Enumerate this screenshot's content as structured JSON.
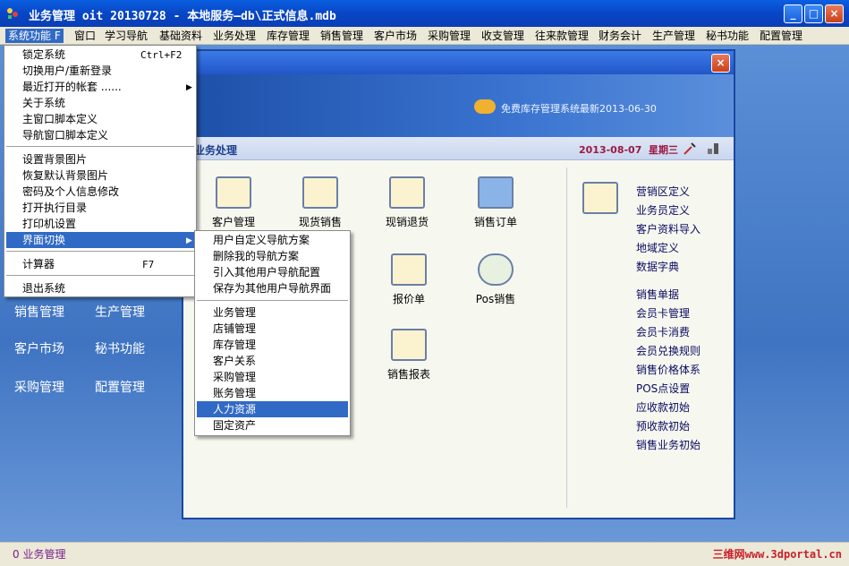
{
  "window": {
    "title": "业务管理 oit 20130728 - 本地服务—db\\正式信息.mdb",
    "minimize": "_",
    "maximize": "□",
    "close": "×"
  },
  "menubar": [
    "系统功能 F",
    "窗口",
    "学习导航",
    "基础资料",
    "业务处理",
    "库存管理",
    "销售管理",
    "客户市场",
    "采购管理",
    "收支管理",
    "往来款管理",
    "财务会计",
    "生产管理",
    "秘书功能",
    "配置管理"
  ],
  "banner": {
    "text": "免费库存管理系统最新2013-06-30"
  },
  "section": {
    "title": "业务处理",
    "date": "2013-08-07",
    "weekday": "星期三"
  },
  "tiles": [
    {
      "label": "客户管理"
    },
    {
      "label": "现货销售"
    },
    {
      "label": "现销退货"
    },
    {
      "label": "销售订单"
    },
    {
      "label": "报价单"
    },
    {
      "label": "Pos销售"
    },
    {
      "label": "销售报表"
    }
  ],
  "right_links": [
    "营销区定义",
    "业务员定义",
    "客户资料导入",
    "地域定义",
    "数据字典",
    "销售单据",
    "会员卡管理",
    "会员卡消费",
    "会员兑换规则",
    "销售价格体系",
    "POS点设置",
    "应收款初始",
    "预收款初始",
    "销售业务初始"
  ],
  "left_nav": [
    "销售管理",
    "生产管理",
    "客户市场",
    "秘书功能",
    "采购管理",
    "配置管理"
  ],
  "system_menu": {
    "items": [
      "锁定系统",
      "切换用户/重新登录",
      "最近打开的帐套 ......",
      "关于系统",
      "主窗口脚本定义",
      "导航窗口脚本定义",
      "设置背景图片",
      "恢复默认背景图片",
      "密码及个人信息修改",
      "打开执行目录",
      "打印机设置",
      "界面切换",
      "计算器",
      "退出系统"
    ],
    "shortcut_lock": "Ctrl+F2",
    "shortcut_calc": "F7"
  },
  "sub_menu": {
    "items": [
      "用户自定义导航方案",
      "删除我的导航方案",
      "引入其他用户导航配置",
      "保存为其他用户导航界面",
      "业务管理",
      "店铺管理",
      "库存管理",
      "客户关系",
      "采购管理",
      "账务管理",
      "人力资源",
      "固定资产"
    ]
  },
  "statusbar": {
    "text": "0 业务管理",
    "watermark": "三维网www.3dportal.cn"
  }
}
